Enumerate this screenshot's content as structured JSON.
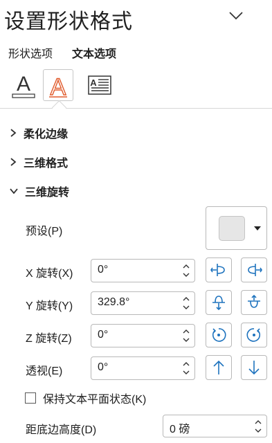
{
  "pane": {
    "title": "设置形状格式",
    "collapse_icon": "chevron-down-icon",
    "tabs": [
      {
        "label": "形状选项",
        "active": false
      },
      {
        "label": "文本选项",
        "active": true
      }
    ],
    "icon_tabs": [
      "text-fill-outline-icon",
      "text-effects-icon",
      "textbox-icon"
    ],
    "accent_color": "#e05a2b"
  },
  "sections": {
    "soft_edges": "柔化边缘",
    "format_3d": "三维格式",
    "rotation_3d": "三维旋转"
  },
  "rotation": {
    "preset_label": "预设(P)",
    "x_label": "X 旋转(X)",
    "x_value": "0°",
    "y_label": "Y 旋转(Y)",
    "y_value": "329.8°",
    "z_label": "Z 旋转(Z)",
    "z_value": "0°",
    "perspective_label": "透视(E)",
    "perspective_value": "0°",
    "keep_flat_label": "保持文本平面状态(K)",
    "keep_flat_checked": false,
    "distance_label": "距底边高度(D)",
    "distance_value": "0 磅"
  },
  "colors": {
    "icon_blue": "#1e73be",
    "border": "#b8b8b8"
  }
}
